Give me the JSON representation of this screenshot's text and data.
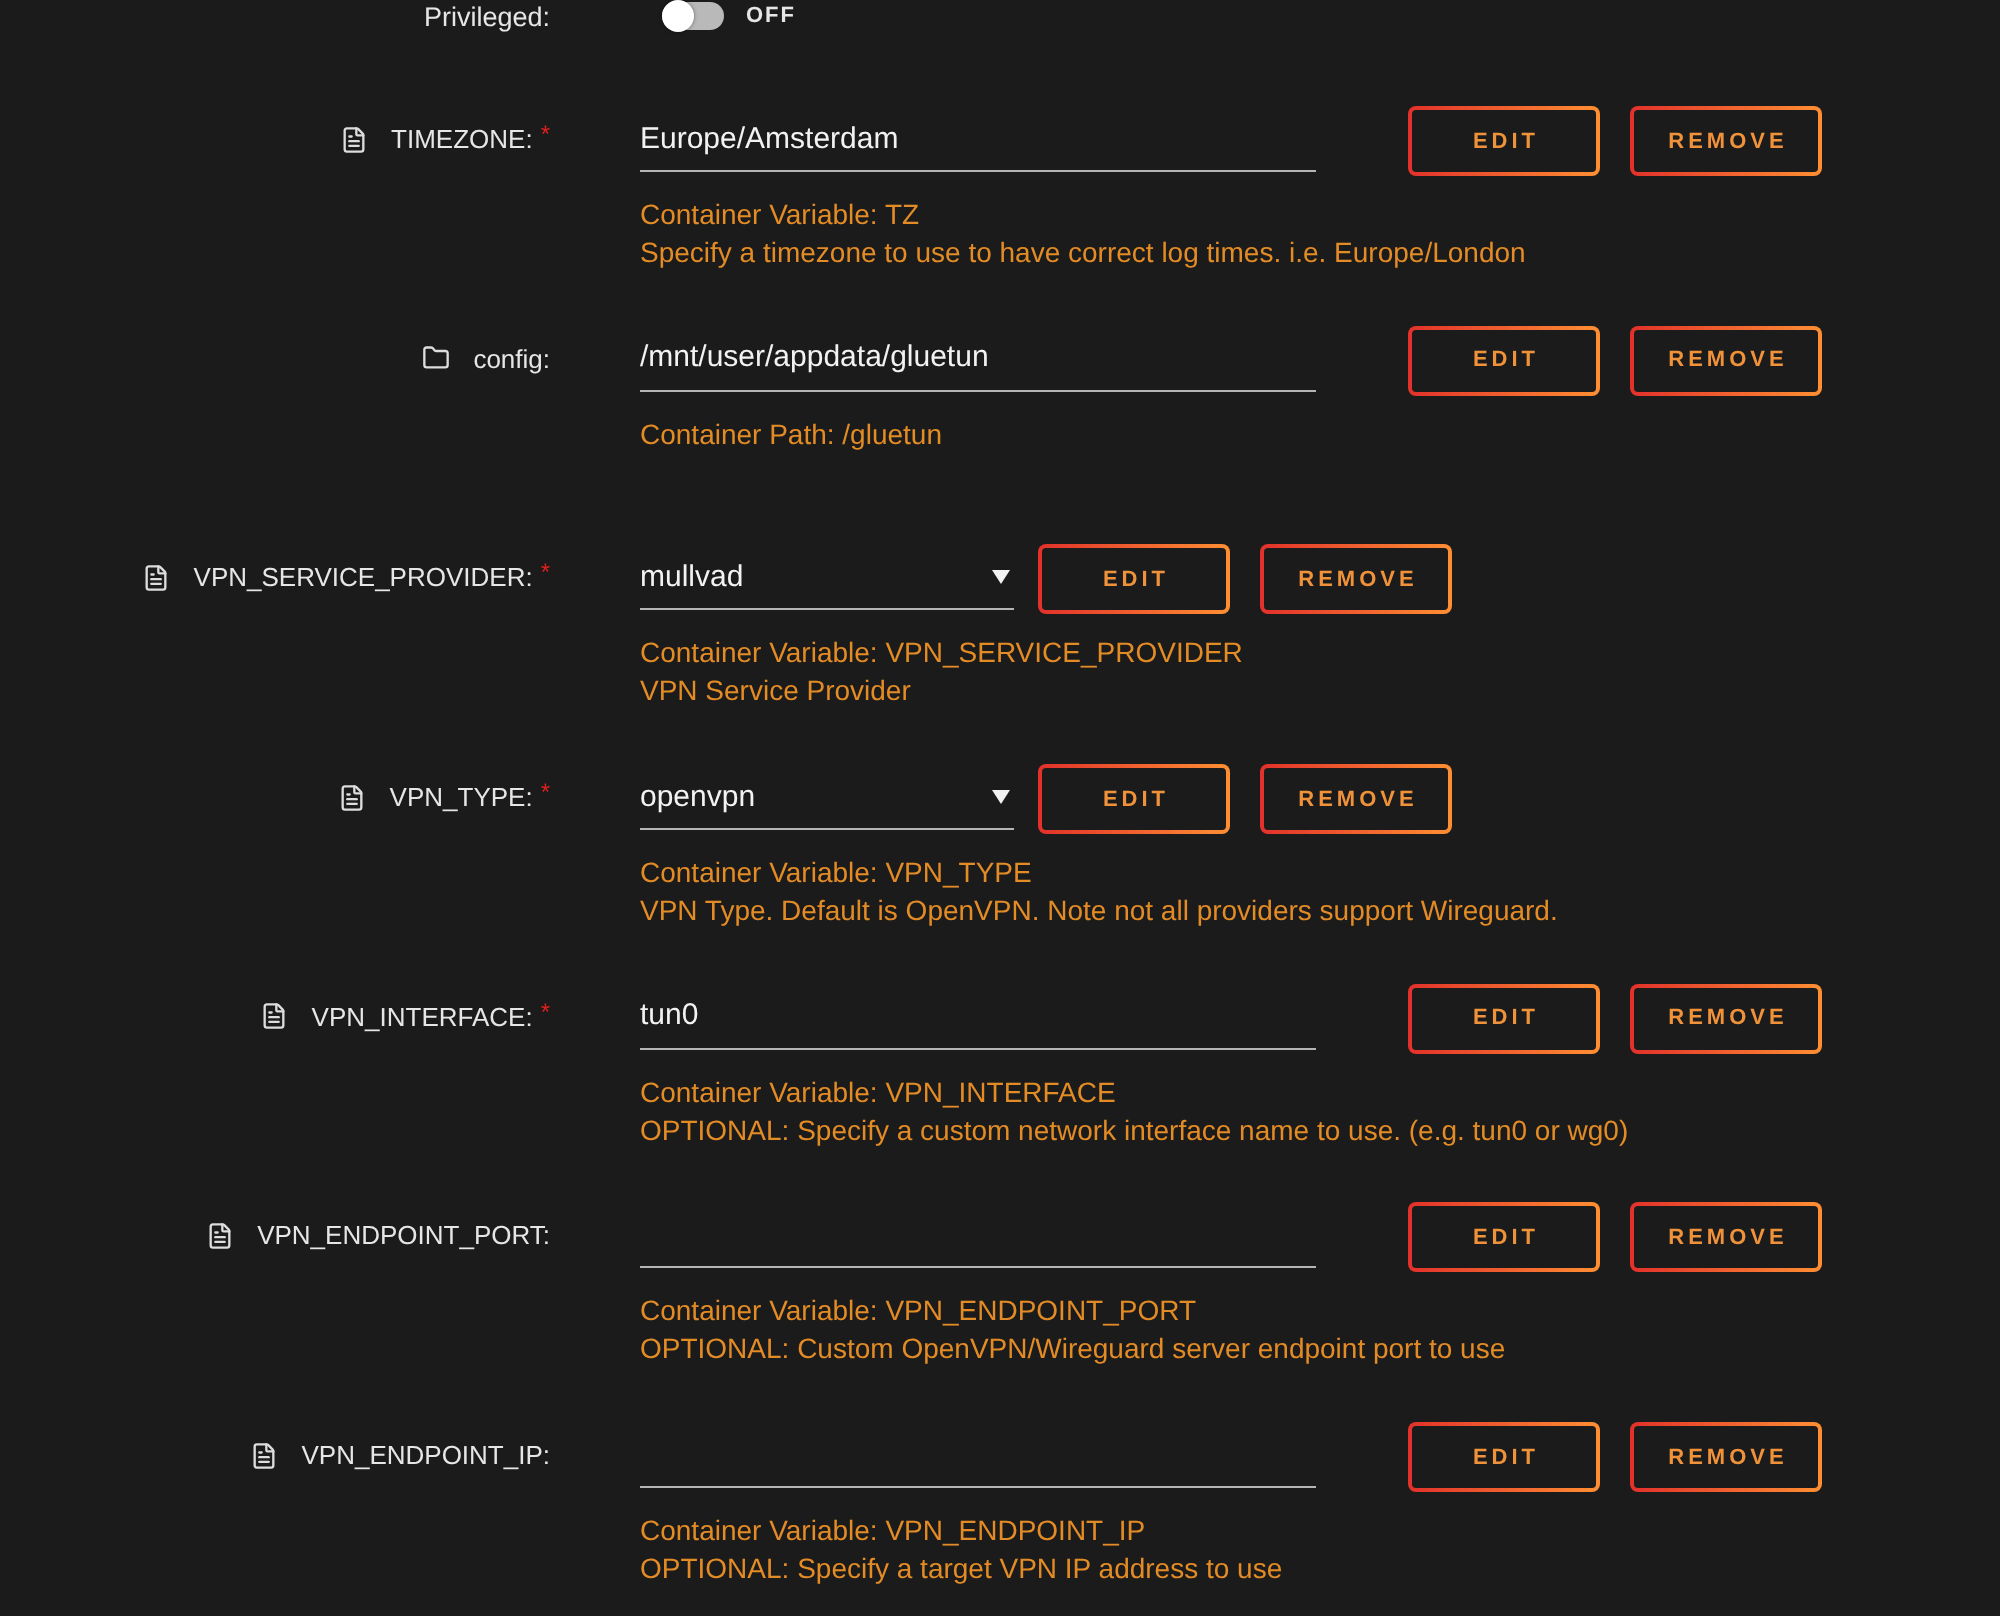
{
  "privileged": {
    "label": "Privileged:",
    "on": false,
    "state_text": "OFF"
  },
  "settings": [
    {
      "kind": "variable",
      "label": "TIMEZONE:",
      "required_mark": "*",
      "field": {
        "kind": "text",
        "value": "Europe/Amsterdam"
      },
      "help": [
        "Container Variable: TZ",
        "Specify a timezone to use to have correct log times. i.e. Europe/London"
      ],
      "buttons": [
        "EDIT",
        "REMOVE"
      ]
    },
    {
      "kind": "path",
      "label": "config:",
      "field": {
        "kind": "text",
        "value": "/mnt/user/appdata/gluetun"
      },
      "help": [
        "Container Path: /gluetun"
      ],
      "buttons": [
        "EDIT",
        "REMOVE"
      ]
    },
    {
      "kind": "variable",
      "label": "VPN_SERVICE_PROVIDER:",
      "required_mark": "*",
      "field": {
        "kind": "select",
        "value": "mullvad"
      },
      "help": [
        "Container Variable: VPN_SERVICE_PROVIDER",
        "VPN Service Provider"
      ],
      "buttons": [
        "EDIT",
        "REMOVE"
      ]
    },
    {
      "kind": "variable",
      "label": "VPN_TYPE:",
      "required_mark": "*",
      "field": {
        "kind": "select",
        "value": "openvpn"
      },
      "help": [
        "Container Variable: VPN_TYPE",
        "VPN Type. Default is OpenVPN. Note not all providers support Wireguard."
      ],
      "buttons": [
        "EDIT",
        "REMOVE"
      ]
    },
    {
      "kind": "variable",
      "label": "VPN_INTERFACE:",
      "required_mark": "*",
      "field": {
        "kind": "text",
        "value": "tun0"
      },
      "help": [
        "Container Variable: VPN_INTERFACE",
        "OPTIONAL: Specify a custom network interface name to use. (e.g. tun0 or wg0)"
      ],
      "buttons": [
        "EDIT",
        "REMOVE"
      ]
    },
    {
      "kind": "variable",
      "label": "VPN_ENDPOINT_PORT:",
      "field": {
        "kind": "text"
      },
      "help": [
        "Container Variable: VPN_ENDPOINT_PORT",
        "OPTIONAL: Custom OpenVPN/Wireguard server endpoint port to use"
      ],
      "buttons": [
        "EDIT",
        "REMOVE"
      ]
    },
    {
      "kind": "variable",
      "label": "VPN_ENDPOINT_IP:",
      "field": {
        "kind": "text"
      },
      "help": [
        "Container Variable: VPN_ENDPOINT_IP",
        "OPTIONAL: Specify a target VPN IP address to use"
      ],
      "buttons": [
        "EDIT",
        "REMOVE"
      ]
    }
  ]
}
